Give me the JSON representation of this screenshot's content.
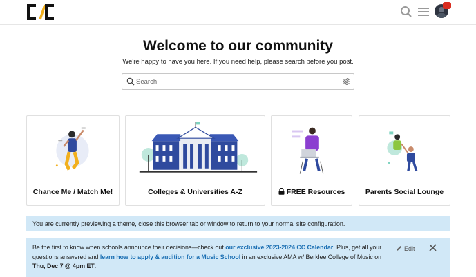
{
  "header": {
    "logo_text": "C/C",
    "icons": [
      "search-icon",
      "hamburger-menu-icon",
      "avatar",
      "notification-badge"
    ]
  },
  "welcome": {
    "title": "Welcome to our community",
    "subtitle": "We're happy to have you here. If you need help, please search before you post."
  },
  "search": {
    "placeholder": "Search"
  },
  "categories": [
    {
      "label": "Chance Me / Match Me!"
    },
    {
      "label": "Colleges & Universities A-Z"
    },
    {
      "label": "FREE Resources"
    },
    {
      "label": "Parents Social Lounge"
    }
  ],
  "preview_banner": {
    "text": "You are currently previewing a theme, close this browser tab or window to return to your normal site configuration."
  },
  "announcement": {
    "part1": "Be the first to know when schools announce their decisions—check out ",
    "link1": "our exclusive 2023-2024 CC Calendar",
    "part2": ". Plus, get all your questions answered and ",
    "link2": "learn how to apply & audition for a Music School",
    "part3": " in an exclusive AMA w/ Berklee College of Music on ",
    "date": "Thu, Dec 7 @ 4pm ET",
    "part4": ".",
    "edit_label": "Edit"
  },
  "colors": {
    "banner_bg": "#d1e8f7",
    "link": "#1b6fb3",
    "logo_accent": "#f2b01e",
    "illustration_blue": "#2f4a9e",
    "illustration_purple": "#8b3fd0"
  }
}
